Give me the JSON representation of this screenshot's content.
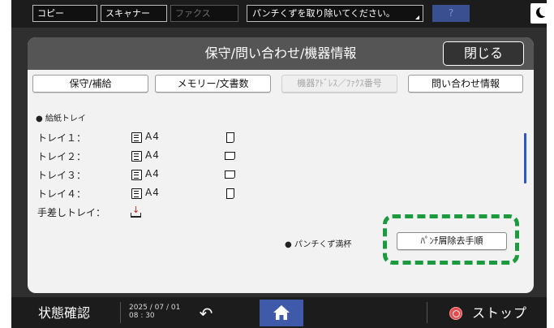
{
  "topbar": {
    "tabs": [
      {
        "label": "コピー",
        "enabled": true
      },
      {
        "label": "スキャナー",
        "enabled": true
      },
      {
        "label": "ファクス",
        "enabled": false
      }
    ],
    "status_message": "パンチくずを取り除いてください。",
    "help_label": "?",
    "night_icon": "moon-icon"
  },
  "dialog": {
    "title": "保守/問い合わせ/機器情報",
    "close_label": "閉じる",
    "tabs": [
      {
        "label": "保守/補給",
        "enabled": true
      },
      {
        "label": "メモリー/文書数",
        "enabled": true
      },
      {
        "label": "機器ｱﾄﾞﾚｽ／ﾌｧｸｽ番号",
        "enabled": false
      },
      {
        "label": "問い合わせ情報",
        "enabled": true
      }
    ],
    "section_title": "● 給紙トレイ",
    "trays": [
      {
        "label": "トレイ１：",
        "size": "A4",
        "orientation": "portrait"
      },
      {
        "label": "トレイ２：",
        "size": "A4",
        "orientation": "landscape"
      },
      {
        "label": "トレイ３：",
        "size": "A4",
        "orientation": "landscape"
      },
      {
        "label": "トレイ４：",
        "size": "A4",
        "orientation": "portrait"
      }
    ],
    "bypass": {
      "label": "手差しトレイ：",
      "icon": "bypass-tray-empty-icon"
    },
    "punch_status": "● パンチくず満杯",
    "punch_button_label": "ﾊﾟﾝﾁ屑除去手順",
    "highlight_color": "#1c9a3e"
  },
  "bottombar": {
    "status_check_label": "状態確認",
    "date": "2025 / 07 / 01",
    "time": "08 : 30",
    "back_icon": "↶",
    "stop_label": "ストップ"
  },
  "colors": {
    "accent": "#3f5aa8",
    "stop": "#e84b4b",
    "scrollbar": "#2f56c4"
  }
}
